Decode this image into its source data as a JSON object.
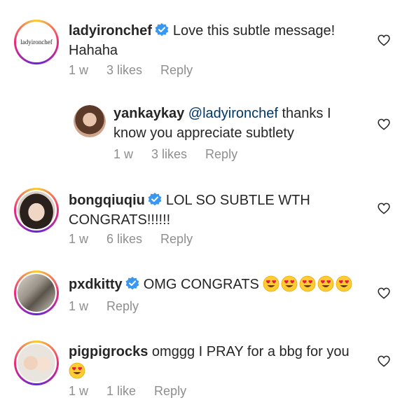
{
  "comments": [
    {
      "username": "ladyironchef",
      "verified": true,
      "avatar_text": "ladyironchef",
      "text": "Love this subtle message! Hahaha",
      "time": "1 w",
      "likes": "3 likes",
      "reply": "Reply"
    },
    {
      "username": "yankaykay",
      "mention": "@ladyironchef",
      "text": "thanks I know you appreciate subtlety",
      "time": "1 w",
      "likes": "3 likes",
      "reply": "Reply"
    },
    {
      "username": "bongqiuqiu",
      "verified": true,
      "text": "LOL SO SUBTLE WTH CONGRATS!!!!!!",
      "time": "1 w",
      "likes": "6 likes",
      "reply": "Reply"
    },
    {
      "username": "pxdkitty",
      "verified": true,
      "text": "OMG CONGRATS",
      "emoji": "heart-eyes",
      "emoji_count": 5,
      "time": "1 w",
      "reply": "Reply"
    },
    {
      "username": "pigpigrocks",
      "text": "omggg I PRAY for a bbg for you",
      "emoji": "heart-eyes",
      "emoji_count": 1,
      "time": "1 w",
      "likes": "1 like",
      "reply": "Reply"
    }
  ],
  "colors": {
    "text": "#262626",
    "meta": "#8e8e8e",
    "verified": "#3897f0",
    "mention": "#00376b"
  }
}
